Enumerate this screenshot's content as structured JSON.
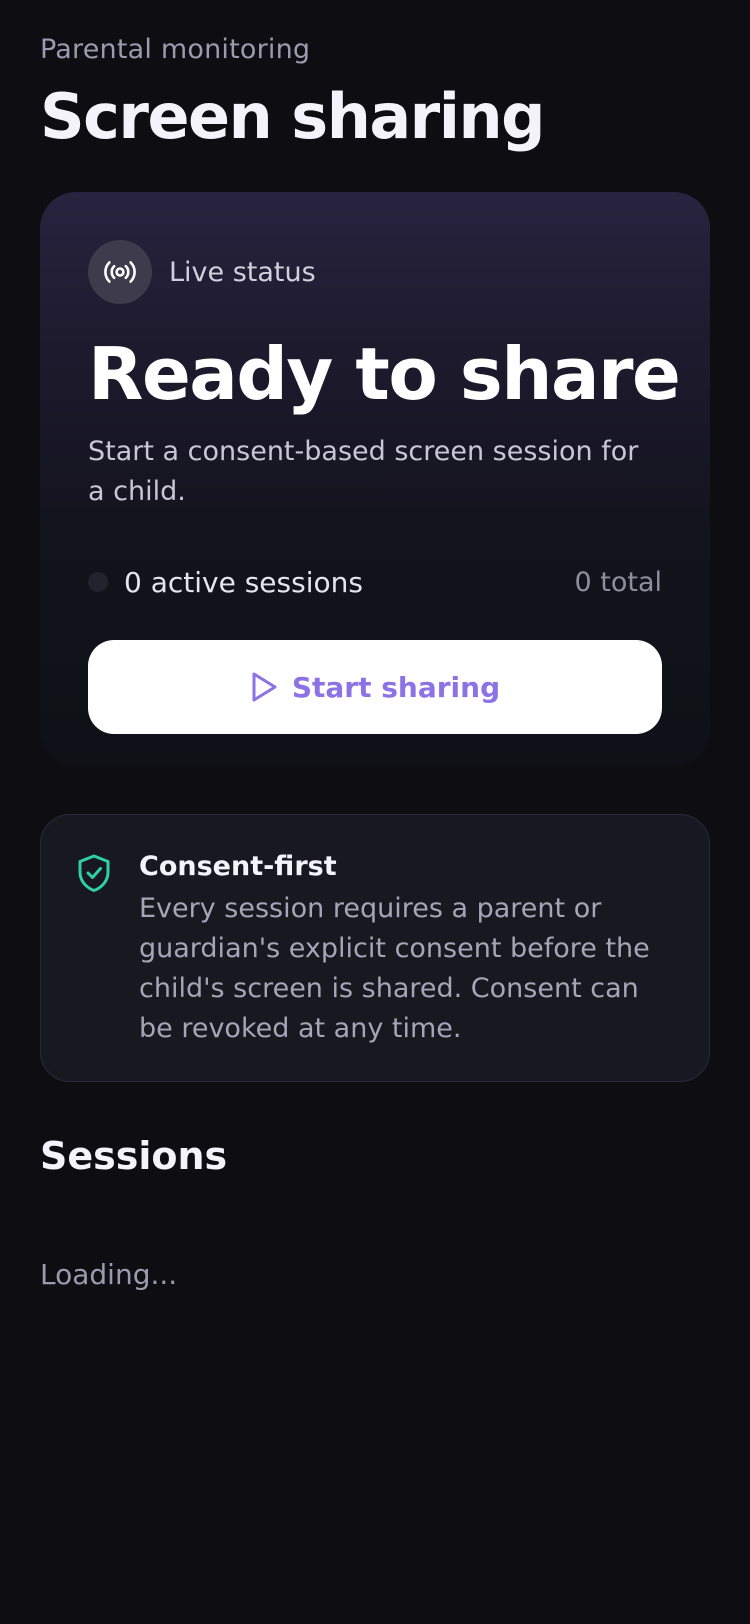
{
  "header": {
    "eyebrow": "Parental monitoring",
    "title": "Screen sharing"
  },
  "hero": {
    "status_icon": "broadcast-icon",
    "status_label": "Live status",
    "title": "Ready to share",
    "description": "Start a consent-based screen session for a child.",
    "active_sessions": "0 active sessions",
    "total_sessions": "0 total",
    "start_button": {
      "icon": "play-icon",
      "label": "Start sharing"
    }
  },
  "consent": {
    "icon": "shield-check-icon",
    "title": "Consent-first",
    "body": "Every session requires a parent or guardian's explicit consent before the child's screen is shared. Consent can be revoked at any time."
  },
  "sessions": {
    "title": "Sessions",
    "loading_text": "Loading..."
  },
  "colors": {
    "background": "#0d0d12",
    "accent": "#8c72e4",
    "consent_icon": "#2fd0a6",
    "card": "#181820"
  }
}
